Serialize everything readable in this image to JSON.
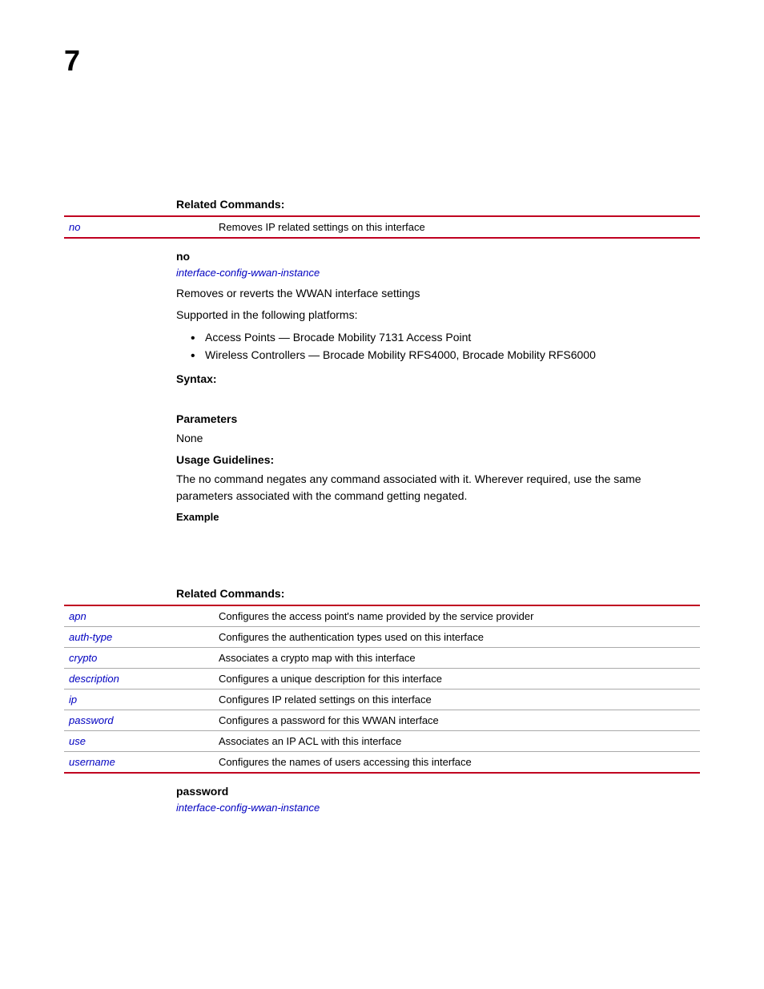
{
  "chapter": "7",
  "section1": {
    "heading": "Related Commands:",
    "table": [
      {
        "cmd": "no",
        "desc": "Removes IP related settings on this interface"
      }
    ]
  },
  "no_section": {
    "title": "no",
    "link": "interface-config-wwan-instance",
    "desc": "Removes or reverts the WWAN interface settings",
    "platforms_intro": "Supported in the following platforms:",
    "platforms": [
      "Access Points — Brocade Mobility 7131 Access Point",
      "Wireless Controllers — Brocade Mobility RFS4000, Brocade Mobility RFS6000"
    ],
    "syntax_heading": "Syntax:",
    "params_heading": "Parameters",
    "params_body": "None",
    "usage_heading": "Usage Guidelines:",
    "usage_body": "The no command negates any command associated with it. Wherever required, use the same parameters associated with the command getting negated.",
    "example_heading": "Example"
  },
  "section2": {
    "heading": "Related Commands:",
    "table": [
      {
        "cmd": "apn",
        "desc": "Configures the access point's name provided by the service provider"
      },
      {
        "cmd": "auth-type",
        "desc": "Configures the authentication types used on this interface"
      },
      {
        "cmd": "crypto",
        "desc": "Associates a crypto map with this interface"
      },
      {
        "cmd": "description",
        "desc": "Configures a unique description for this interface"
      },
      {
        "cmd": "ip",
        "desc": "Configures IP related settings on this interface"
      },
      {
        "cmd": "password",
        "desc": "Configures a password for this WWAN interface"
      },
      {
        "cmd": "use",
        "desc": "Associates an IP ACL with this interface"
      },
      {
        "cmd": "username",
        "desc": "Configures the names of users accessing this interface"
      }
    ]
  },
  "password_section": {
    "title": "password",
    "link": "interface-config-wwan-instance"
  }
}
